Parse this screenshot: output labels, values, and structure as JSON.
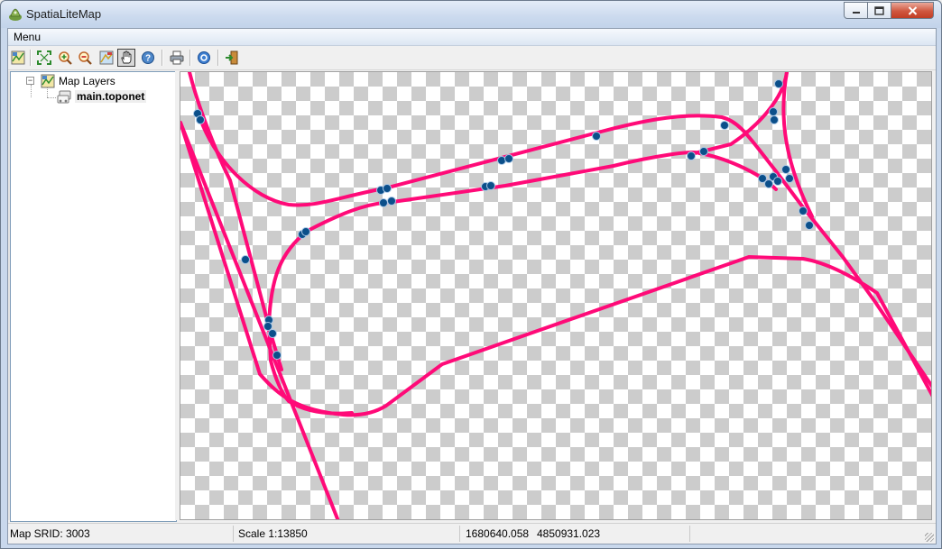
{
  "window": {
    "title": "SpatiaLiteMap",
    "icon": "spatialite-app-icon",
    "controls": {
      "minimize": "minimize-icon",
      "maximize": "maximize-icon",
      "close": "close-icon"
    }
  },
  "menubar": {
    "items": [
      {
        "label": "Menu"
      }
    ]
  },
  "toolbar": {
    "buttons": [
      {
        "name": "layers-config",
        "icon": "map-layers-icon"
      },
      {
        "name": "zoom-full",
        "icon": "zoom-full-extent-icon"
      },
      {
        "name": "zoom-in",
        "icon": "zoom-in-icon"
      },
      {
        "name": "zoom-out",
        "icon": "zoom-out-icon"
      },
      {
        "name": "map-view",
        "icon": "map-view-icon"
      },
      {
        "name": "pan",
        "icon": "pan-hand-icon",
        "active": true
      },
      {
        "name": "identify",
        "icon": "identify-icon"
      },
      {
        "name": "print",
        "icon": "printer-icon"
      },
      {
        "name": "help",
        "icon": "help-icon"
      },
      {
        "name": "exit",
        "icon": "exit-icon"
      }
    ]
  },
  "tree": {
    "root": {
      "label": "Map Layers",
      "expanded": true,
      "toggle": "−"
    },
    "children": [
      {
        "label": "main.toponet",
        "selected": true
      }
    ]
  },
  "map": {
    "line_color": "#ff0a78",
    "node_fill": "#0b4f8a",
    "node_stroke": "#a9c7e6",
    "background": "transparent-checkerboard"
  },
  "statusbar": {
    "srid": "Map SRID: 3003",
    "scale": "Scale 1:13850",
    "coord_x": "1680640.058",
    "coord_y": "4850931.023"
  }
}
